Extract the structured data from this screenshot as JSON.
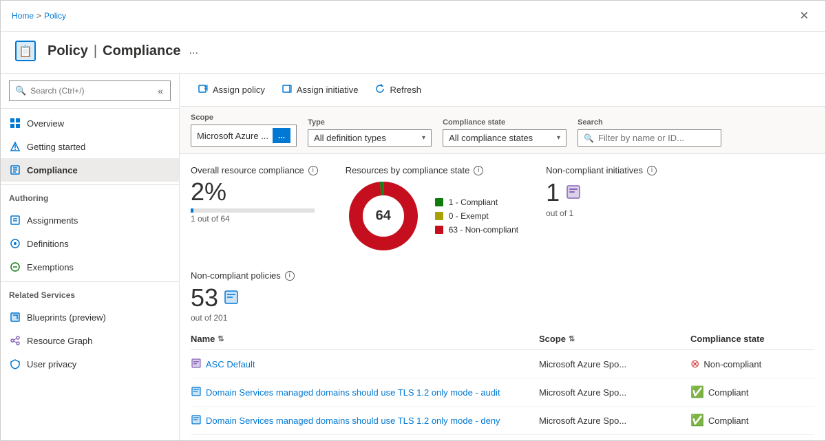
{
  "breadcrumb": {
    "home": "Home",
    "separator": ">",
    "policy": "Policy"
  },
  "header": {
    "title": "Policy",
    "separator": "|",
    "subtitle": "Compliance",
    "ellipsis": "..."
  },
  "close_btn": "✕",
  "toolbar": {
    "assign_policy_label": "Assign policy",
    "assign_initiative_label": "Assign initiative",
    "refresh_label": "Refresh"
  },
  "filters": {
    "scope_label": "Scope",
    "scope_value": "Microsoft Azure ...",
    "type_label": "Type",
    "type_value": "All definition types",
    "compliance_state_label": "Compliance state",
    "compliance_state_value": "All compliance states",
    "search_label": "Search",
    "search_placeholder": "Filter by name or ID..."
  },
  "sidebar": {
    "search_placeholder": "Search (Ctrl+/)",
    "nav_items": [
      {
        "id": "overview",
        "label": "Overview",
        "icon": "🏠",
        "active": false
      },
      {
        "id": "getting-started",
        "label": "Getting started",
        "icon": "🚀",
        "active": false
      },
      {
        "id": "compliance",
        "label": "Compliance",
        "icon": "📋",
        "active": true
      }
    ],
    "authoring_header": "Authoring",
    "authoring_items": [
      {
        "id": "assignments",
        "label": "Assignments",
        "icon": "📄",
        "active": false
      },
      {
        "id": "definitions",
        "label": "Definitions",
        "icon": "⊙",
        "active": false
      },
      {
        "id": "exemptions",
        "label": "Exemptions",
        "icon": "🚫",
        "active": false
      }
    ],
    "related_header": "Related Services",
    "related_items": [
      {
        "id": "blueprints",
        "label": "Blueprints (preview)",
        "icon": "🔷",
        "active": false
      },
      {
        "id": "resource-graph",
        "label": "Resource Graph",
        "icon": "🔗",
        "active": false
      },
      {
        "id": "user-privacy",
        "label": "User privacy",
        "icon": "🔒",
        "active": false
      }
    ]
  },
  "compliance": {
    "overall_title": "Overall resource compliance",
    "overall_percent": "2%",
    "overall_detail": "1 out of 64",
    "overall_progress": 2,
    "donut_title": "Resources by compliance state",
    "donut_total": "64",
    "legend": [
      {
        "label": "1 - Compliant",
        "color": "#107c10"
      },
      {
        "label": "0 - Exempt",
        "color": "#a8a006"
      },
      {
        "label": "63 - Non-compliant",
        "color": "#c50f1f"
      }
    ],
    "donut_compliant": 1,
    "donut_exempt": 0,
    "donut_noncompliant": 63,
    "initiatives_title": "Non-compliant initiatives",
    "initiatives_num": "1",
    "initiatives_sub": "out of 1",
    "policies_title": "Non-compliant policies",
    "policies_num": "53",
    "policies_sub": "out of 201",
    "table": {
      "col_name": "Name",
      "col_scope": "Scope",
      "col_status": "Compliance state",
      "rows": [
        {
          "name": "ASC Default",
          "scope": "Microsoft Azure Spo...",
          "status": "Non-compliant",
          "status_type": "non-compliant",
          "icon_type": "initiative"
        },
        {
          "name": "Domain Services managed domains should use TLS 1.2 only mode - audit",
          "scope": "Microsoft Azure Spo...",
          "status": "Compliant",
          "status_type": "compliant",
          "icon_type": "policy"
        },
        {
          "name": "Domain Services managed domains should use TLS 1.2 only mode - deny",
          "scope": "Microsoft Azure Spo...",
          "status": "Compliant",
          "status_type": "compliant",
          "icon_type": "policy"
        }
      ]
    }
  }
}
